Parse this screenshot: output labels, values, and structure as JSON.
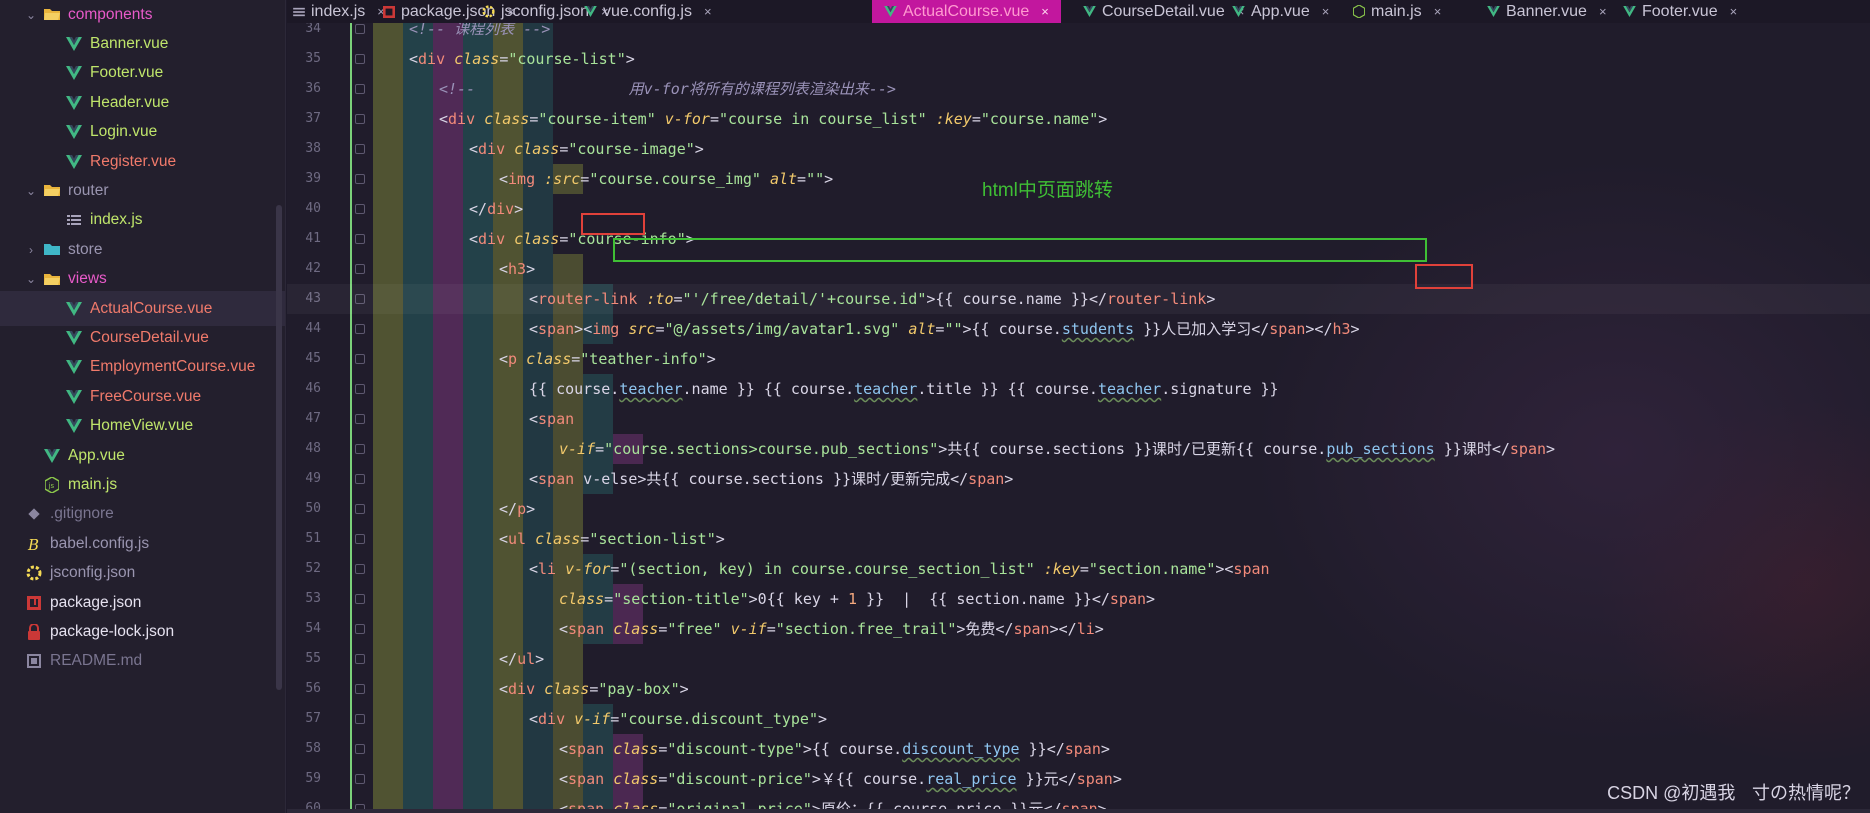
{
  "sidebar": {
    "items": [
      {
        "label": "components",
        "kind": "folder-open",
        "color": "#e85ac9"
      },
      {
        "label": "Banner.vue",
        "kind": "vue",
        "color": "#bfe56b"
      },
      {
        "label": "Footer.vue",
        "kind": "vue",
        "color": "#bfe56b"
      },
      {
        "label": "Header.vue",
        "kind": "vue",
        "color": "#bfe56b"
      },
      {
        "label": "Login.vue",
        "kind": "vue",
        "color": "#bfe56b"
      },
      {
        "label": "Register.vue",
        "kind": "vue",
        "color": "#f07a6b"
      },
      {
        "label": "router",
        "kind": "folder-open",
        "color": "#9a95b0"
      },
      {
        "label": "index.js",
        "kind": "list",
        "color": "#bfe56b"
      },
      {
        "label": "store",
        "kind": "folder-closed",
        "color": "#9a95b0"
      },
      {
        "label": "views",
        "kind": "folder-open",
        "color": "#e85ac9"
      },
      {
        "label": "ActualCourse.vue",
        "kind": "vue",
        "color": "#f07a6b"
      },
      {
        "label": "CourseDetail.vue",
        "kind": "vue",
        "color": "#f07a6b"
      },
      {
        "label": "EmploymentCourse.vue",
        "kind": "vue",
        "color": "#f07a6b"
      },
      {
        "label": "FreeCourse.vue",
        "kind": "vue",
        "color": "#f07a6b"
      },
      {
        "label": "HomeView.vue",
        "kind": "vue",
        "color": "#bfe56b"
      },
      {
        "label": "App.vue",
        "kind": "vue",
        "color": "#bfe56b"
      },
      {
        "label": "main.js",
        "kind": "js",
        "color": "#bfe56b"
      },
      {
        "label": ".gitignore",
        "kind": "git",
        "color": "#7a7590"
      },
      {
        "label": "babel.config.js",
        "kind": "babel",
        "color": "#9a95b0"
      },
      {
        "label": "jsconfig.json",
        "kind": "json",
        "color": "#9a95b0"
      },
      {
        "label": "package.json",
        "kind": "npm",
        "color": "#e6e2f0"
      },
      {
        "label": "package-lock.json",
        "kind": "lock",
        "color": "#e6e2f0"
      },
      {
        "label": "README.md",
        "kind": "md",
        "color": "#7a7590"
      }
    ]
  },
  "tabs": [
    {
      "label": "index.js",
      "icon": "list-icon"
    },
    {
      "label": "package.json",
      "icon": "npm-icon"
    },
    {
      "label": "jsconfig.json",
      "icon": "json-icon"
    },
    {
      "label": "vue.config.js",
      "icon": "vue-icon"
    },
    {
      "label": "ActualCourse.vue",
      "icon": "vue-icon",
      "active": true
    },
    {
      "label": "CourseDetail.vue",
      "icon": "vue-icon"
    },
    {
      "label": "App.vue",
      "icon": "vue-icon"
    },
    {
      "label": "main.js",
      "icon": "js-icon"
    },
    {
      "label": "Banner.vue",
      "icon": "vue-icon"
    },
    {
      "label": "Footer.vue",
      "icon": "vue-icon"
    }
  ],
  "tab_close_glyph": "×",
  "editor": {
    "first_line_number": 34,
    "top_partial_line": "<!-- 课程列表 -->",
    "lines": [
      "<div class=\"course-list\">",
      "<!--                 用v-for将所有的课程列表渲染出来-->",
      "<div class=\"course-item\" v-for=\"course in course_list\" :key=\"course.name\">",
      "<div class=\"course-image\">",
      "<img :src=\"course.course_img\" alt=\"\">",
      "</div>",
      "<div class=\"course-info\">",
      "<h3>",
      "<router-link :to=\"'/free/detail/'+course.id\">{{ course.name }}</router-link>",
      "<span><img src=\"@/assets/img/avatar1.svg\" alt=\"\">{{ course.students }}人已加入学习</span></h3>",
      "<p class=\"teather-info\">",
      "{{ course.teacher.name }} {{ course.teacher.title }} {{ course.teacher.signature }}",
      "<span",
      "v-if=\"course.sections>course.pub_sections\">共{{ course.sections }}课时/已更新{{ course.pub_sections }}课时</span>",
      "<span v-else>共{{ course.sections }}课时/更新完成</span>",
      "</p>",
      "<ul class=\"section-list\">",
      "<li v-for=\"(section, key) in course.course_section_list\" :key=\"section.name\"><span",
      "class=\"section-title\">0{{ key + 1 }}  |  {{ section.name }}</span>",
      "<span class=\"free\" v-if=\"section.free_trail\">免费</span></li>",
      "</ul>",
      "<div class=\"pay-box\">",
      "<div v-if=\"course.discount_type\">",
      "<span class=\"discount-type\">{{ course.discount_type }}</span>",
      "<span class=\"discount-price\">￥{{ course.real_price }}元</span>",
      "<span class=\"original-price\">原价：{{ course.price }}元</span>"
    ],
    "current_line": 43
  },
  "annotation_text": "html中页面跳转",
  "watermark": "CSDN @初遇我ㅤ寸の热情呢？",
  "colors": {
    "annotation_green": "#3fbf35",
    "highlight_red": "#e0413a",
    "tab_active": "#c2179e"
  }
}
